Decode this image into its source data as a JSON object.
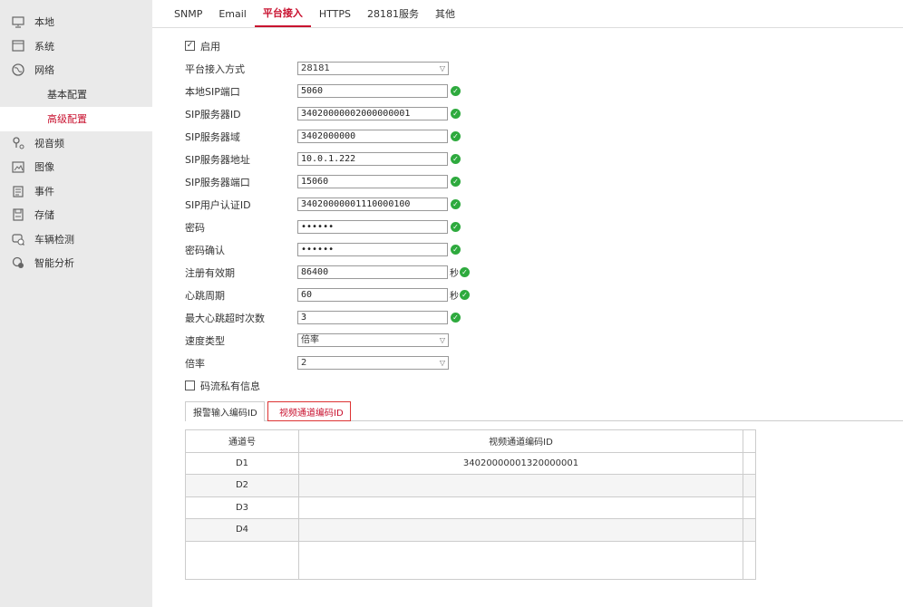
{
  "sidebar": {
    "items": [
      {
        "label": "本地",
        "icon": "monitor-icon"
      },
      {
        "label": "系统",
        "icon": "window-icon"
      },
      {
        "label": "网络",
        "icon": "globe-icon"
      }
    ],
    "network_subitems": [
      {
        "label": "基本配置",
        "active": false
      },
      {
        "label": "高级配置",
        "active": true
      }
    ],
    "items_after": [
      {
        "label": "视音频",
        "icon": "audio-video-icon"
      },
      {
        "label": "图像",
        "icon": "image-icon"
      },
      {
        "label": "事件",
        "icon": "event-icon"
      },
      {
        "label": "存储",
        "icon": "storage-icon"
      },
      {
        "label": "车辆检测",
        "icon": "vehicle-detect-icon"
      },
      {
        "label": "智能分析",
        "icon": "smart-analysis-icon"
      }
    ]
  },
  "tabs": [
    "SNMP",
    "Email",
    "平台接入",
    "HTTPS",
    "28181服务",
    "其他"
  ],
  "active_tab": "平台接入",
  "form": {
    "enable": {
      "label": "启用",
      "checked": true
    },
    "access_mode": {
      "label": "平台接入方式",
      "value": "28181"
    },
    "local_sip_port": {
      "label": "本地SIP端口",
      "value": "5060"
    },
    "sip_server_id": {
      "label": "SIP服务器ID",
      "value": "34020000002000000001"
    },
    "sip_server_domain": {
      "label": "SIP服务器域",
      "value": "3402000000"
    },
    "sip_server_addr": {
      "label": "SIP服务器地址",
      "value": "10.0.1.222"
    },
    "sip_server_port": {
      "label": "SIP服务器端口",
      "value": "15060"
    },
    "sip_user_auth_id": {
      "label": "SIP用户认证ID",
      "value": "34020000001110000100"
    },
    "password": {
      "label": "密码",
      "value": "••••••"
    },
    "password_confirm": {
      "label": "密码确认",
      "value": "••••••"
    },
    "register_validity": {
      "label": "注册有效期",
      "value": "86400",
      "unit": "秒"
    },
    "heartbeat_period": {
      "label": "心跳周期",
      "value": "60",
      "unit": "秒"
    },
    "max_heartbeat_timeout": {
      "label": "最大心跳超时次数",
      "value": "3"
    },
    "speed_type": {
      "label": "速度类型",
      "value": "倍率"
    },
    "rate": {
      "label": "倍率",
      "value": "2"
    },
    "stream_private": {
      "label": "码流私有信息",
      "checked": false
    }
  },
  "subtabs": {
    "alarm_input": "报警输入编码ID",
    "video_channel": "视频通道编码ID"
  },
  "table": {
    "headers": [
      "通道号",
      "视频通道编码ID"
    ],
    "rows": [
      {
        "channel": "D1",
        "code": "34020000001320000001"
      },
      {
        "channel": "D2",
        "code": ""
      },
      {
        "channel": "D3",
        "code": ""
      },
      {
        "channel": "D4",
        "code": ""
      }
    ]
  },
  "colors": {
    "accent": "#c8102e",
    "ok": "#2eaa3e",
    "sidebar_bg": "#eaeaea"
  }
}
